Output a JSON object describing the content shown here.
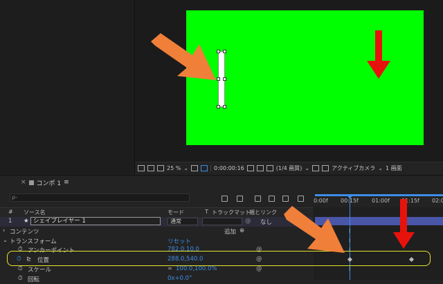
{
  "viewer": {
    "zoom": "25 %",
    "timecode": "0:00:00:16",
    "resolution": "(1/4 画質)",
    "camera": "アクティブカメラ",
    "views": "1 画面"
  },
  "timeline": {
    "tab_label": "コンポ 1",
    "search_placeholder": "ρ-",
    "columns": {
      "hash": "#",
      "source_name": "ソース名",
      "mode": "モード",
      "t": "T",
      "track_matte": "トラックマット",
      "parent_link": "親とリンク"
    },
    "layer": {
      "index": "1",
      "name": "シェイプレイヤー 1",
      "mode": "通常",
      "parent": "なし"
    },
    "rows": {
      "contents": "コンテンツ",
      "add": "追加",
      "transform": "トランスフォーム",
      "reset": "リセット",
      "anchor_label": "アンカーポイント",
      "anchor_value": "782.0,10.0",
      "position_label": "位置",
      "position_value": "288.0,540.0",
      "scale_label": "スケール",
      "scale_value": "100.0,100.0%",
      "rotation_label": "回転",
      "rotation_value": "0x+0.0°"
    },
    "ruler": [
      "0:00f",
      "00:15f",
      "01:00f",
      "01:15f",
      "02:0"
    ]
  },
  "colors": {
    "canvas": "#00ff00",
    "accent_blue": "#3d8ee8",
    "highlight": "#e6e62c",
    "arrow_orange": "#f07f3a",
    "arrow_red": "#e8120c"
  }
}
